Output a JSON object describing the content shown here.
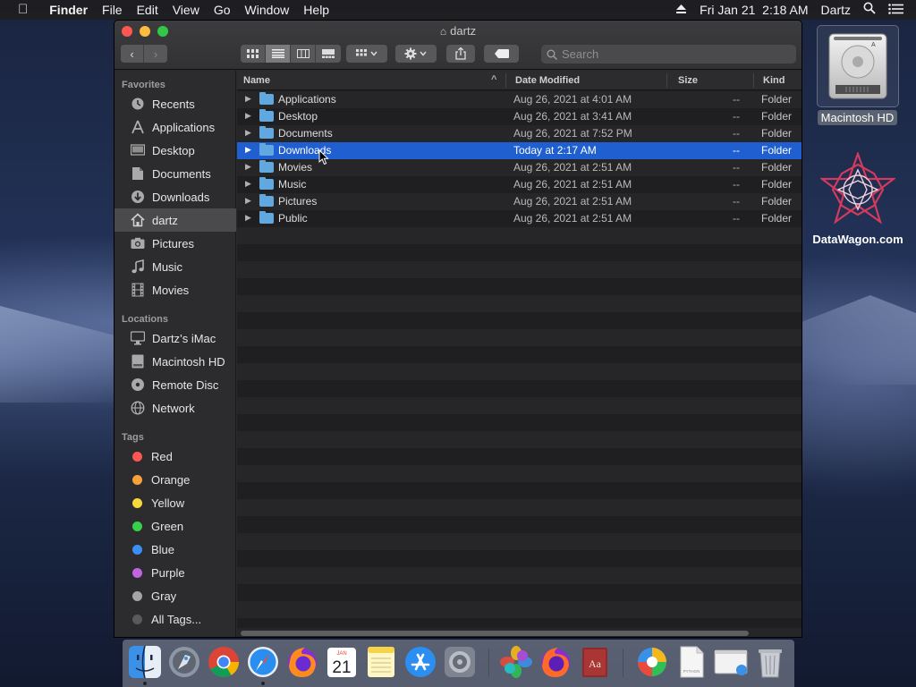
{
  "menubar": {
    "app_name": "Finder",
    "menus": [
      "File",
      "Edit",
      "View",
      "Go",
      "Window",
      "Help"
    ],
    "clock": "Fri Jan 21  2:18 AM",
    "user": "Dartz"
  },
  "window": {
    "title": "dartz",
    "search_placeholder": "Search",
    "sidebar": {
      "favorites_heading": "Favorites",
      "favorites": [
        {
          "label": "Recents",
          "icon": "clock-icon"
        },
        {
          "label": "Applications",
          "icon": "applications-icon"
        },
        {
          "label": "Desktop",
          "icon": "desktop-icon"
        },
        {
          "label": "Documents",
          "icon": "document-icon"
        },
        {
          "label": "Downloads",
          "icon": "download-icon"
        },
        {
          "label": "dartz",
          "icon": "home-icon",
          "selected": true
        },
        {
          "label": "Pictures",
          "icon": "camera-icon"
        },
        {
          "label": "Music",
          "icon": "music-icon"
        },
        {
          "label": "Movies",
          "icon": "film-icon"
        }
      ],
      "locations_heading": "Locations",
      "locations": [
        {
          "label": "Dartz’s iMac",
          "icon": "computer-icon"
        },
        {
          "label": "Macintosh HD",
          "icon": "hard-drive-icon"
        },
        {
          "label": "Remote Disc",
          "icon": "disc-icon"
        },
        {
          "label": "Network",
          "icon": "globe-icon"
        }
      ],
      "tags_heading": "Tags",
      "tags": [
        {
          "label": "Red",
          "color": "#fc5753"
        },
        {
          "label": "Orange",
          "color": "#f9a13a"
        },
        {
          "label": "Yellow",
          "color": "#f5d83a"
        },
        {
          "label": "Green",
          "color": "#37d04b"
        },
        {
          "label": "Blue",
          "color": "#3a8ef5"
        },
        {
          "label": "Purple",
          "color": "#c064e0"
        },
        {
          "label": "Gray",
          "color": "#a5a5a7"
        },
        {
          "label": "All Tags...",
          "color": "#5a5a5c"
        }
      ]
    },
    "columns": {
      "name": "Name",
      "date": "Date Modified",
      "size": "Size",
      "kind": "Kind"
    },
    "files": [
      {
        "name": "Applications",
        "date": "Aug 26, 2021 at 4:01 AM",
        "size": "--",
        "kind": "Folder"
      },
      {
        "name": "Desktop",
        "date": "Aug 26, 2021 at 3:41 AM",
        "size": "--",
        "kind": "Folder"
      },
      {
        "name": "Documents",
        "date": "Aug 26, 2021 at 7:52 PM",
        "size": "--",
        "kind": "Folder"
      },
      {
        "name": "Downloads",
        "date": "Today at 2:17 AM",
        "size": "--",
        "kind": "Folder",
        "selected": true
      },
      {
        "name": "Movies",
        "date": "Aug 26, 2021 at 2:51 AM",
        "size": "--",
        "kind": "Folder"
      },
      {
        "name": "Music",
        "date": "Aug 26, 2021 at 2:51 AM",
        "size": "--",
        "kind": "Folder"
      },
      {
        "name": "Pictures",
        "date": "Aug 26, 2021 at 2:51 AM",
        "size": "--",
        "kind": "Folder"
      },
      {
        "name": "Public",
        "date": "Aug 26, 2021 at 2:51 AM",
        "size": "--",
        "kind": "Folder"
      }
    ]
  },
  "desktop": {
    "drive_label": "Macintosh HD",
    "drive_badge": "A",
    "site_label": "DataWagon.com"
  },
  "dock": {
    "apps": [
      "finder-icon",
      "launchpad-icon",
      "chrome-icon",
      "safari-icon",
      "firefox-icon",
      "calendar-icon",
      "notes-icon",
      "app-store-icon",
      "system-preferences-icon",
      "photos-icon",
      "firefox-alt-icon",
      "dictionary-icon",
      "color-picker-icon",
      "python-file-icon",
      "preview-icon",
      "trash-icon"
    ],
    "calendar_month": "JAN",
    "calendar_day": "21",
    "dictionary_glyph": "Aa",
    "python_file_label": "PYTHON"
  }
}
